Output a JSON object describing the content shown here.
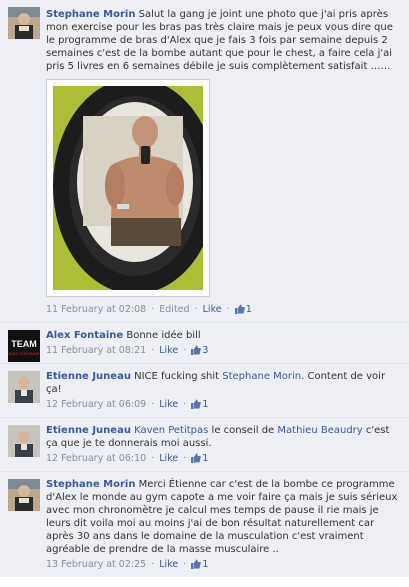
{
  "comments": [
    {
      "author": "Stephane Morin",
      "text": "Salut la gang je joint une photo que j'ai pris après mon exercise pour les bras pas très claire mais je peux vous dire que le programme de bras d'Alex que je fais 3 fois par semaine depuis 2 semaines c'est de la bombe autant que pour le chest, a faire cela j'ai pris 5 livres en 6 semaines débile je suis complètement satisfait ……",
      "time": "11 February at 02:08",
      "edited": "Edited",
      "like": "Like",
      "likes": "1"
    },
    {
      "author": "Alex Fontaine",
      "text": "Bonne idée bill",
      "time": "11 February at 08:21",
      "like": "Like",
      "likes": "3",
      "avatar_text": "TEAM",
      "avatar_sub": "ALEX FONTAINE"
    },
    {
      "author": "Etienne Juneau",
      "text_pre": "NICE fucking shit ",
      "mention": "Stephane Morin",
      "text_post": ". Content de voir ça!",
      "time": "12 February at 06:09",
      "like": "Like",
      "likes": "1"
    },
    {
      "author": "Etienne Juneau",
      "mention1": "Kaven Petitpas",
      "text_mid": " le conseil de ",
      "mention2": "Mathieu Beaudry",
      "text_post": " c'est ça que je te donnerais moi aussi.",
      "time": "12 February at 06:10",
      "like": "Like",
      "likes": "1"
    },
    {
      "author": "Stephane Morin",
      "text": "Merci Étienne car c'est de la bombe ce programme d'Alex le monde au gym capote a me voir faire ça mais je suis sérieux avec mon chronomètre je calcul mes temps de pause il rie mais je leurs dit voila moi au moins j'ai de bon résultat naturellement car après 30 ans dans le domaine de la musculation c'est vraiment agréable de prendre de la masse musculaire ..",
      "time": "13 February at 02:25",
      "like": "Like",
      "likes": "1"
    }
  ],
  "separator": "·",
  "colors": {
    "link": "#3b5998",
    "background": "#edeff4",
    "meta": "#8a8f99"
  },
  "icons": {
    "like": "thumbs-up-icon"
  }
}
